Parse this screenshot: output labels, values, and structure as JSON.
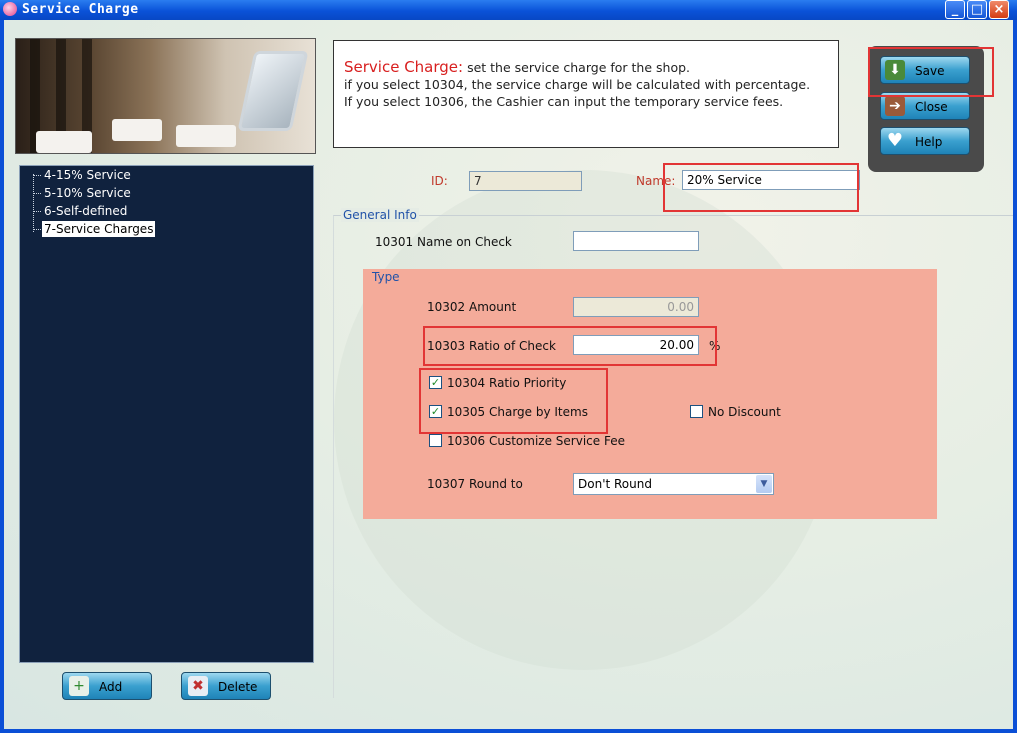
{
  "window": {
    "title": "Service Charge",
    "minimize": "_",
    "maximize": "□",
    "close": "×"
  },
  "info": {
    "title": "Service Charge:",
    "line1": "set the service charge for the shop.",
    "line2": "if you select 10304, the service charge will be calculated with percentage.",
    "line3": "If you select 10306, the Cashier can input the temporary service fees."
  },
  "actions": {
    "save": "Save",
    "close": "Close",
    "help": "Help"
  },
  "tree": {
    "items": [
      {
        "label": "4-15% Service"
      },
      {
        "label": "5-10% Service"
      },
      {
        "label": "6-Self-defined"
      },
      {
        "label": "7-Service Charges"
      }
    ]
  },
  "bottom": {
    "add": "Add",
    "delete": "Delete"
  },
  "form": {
    "id_label": "ID:",
    "id_value": "7",
    "name_label": "Name:",
    "name_value": "20% Service",
    "general_info": "General Info",
    "name_on_check_label": "10301 Name on Check",
    "name_on_check_value": "",
    "type_title": "Type",
    "amount_label": "10302 Amount",
    "amount_value": "0.00",
    "ratio_label": "10303 Ratio of Check",
    "ratio_value": "20.00",
    "ratio_unit": "%",
    "ratio_priority_label": "10304 Ratio Priority",
    "ratio_priority_checked": true,
    "charge_by_items_label": "10305 Charge by Items",
    "charge_by_items_checked": true,
    "no_discount_label": "No Discount",
    "no_discount_checked": false,
    "customize_fee_label": "10306 Customize Service Fee",
    "customize_fee_checked": false,
    "round_label": "10307 Round to",
    "round_value": "Don't Round",
    "check_glyph": "✓"
  },
  "colors": {
    "highlight": "#e23535",
    "type_bg": "#f4ab9a",
    "tree_bg": "#10223e",
    "button_blue": "#3aa0cf"
  }
}
